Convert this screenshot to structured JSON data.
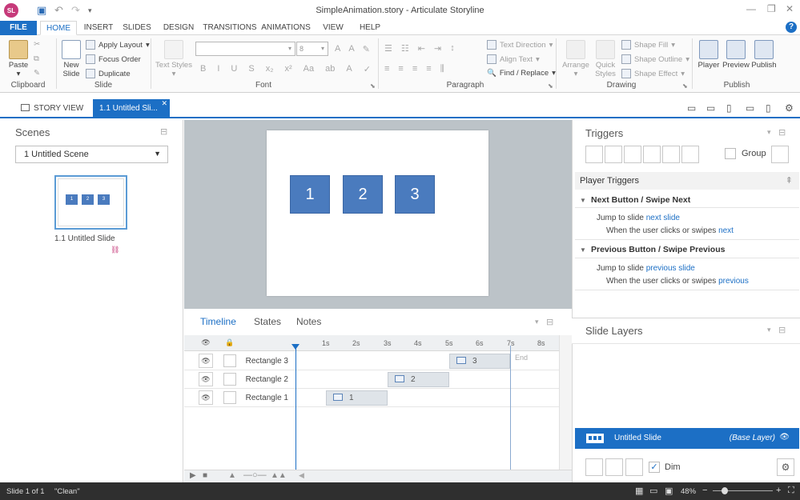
{
  "window": {
    "title": "SimpleAnimation.story - Articulate Storyline",
    "app_badge": "SL"
  },
  "ribbon_tabs": [
    "FILE",
    "HOME",
    "INSERT",
    "SLIDES",
    "DESIGN",
    "TRANSITIONS",
    "ANIMATIONS",
    "VIEW",
    "HELP"
  ],
  "ribbon": {
    "clipboard": {
      "paste": "Paste",
      "label": "Clipboard"
    },
    "slide": {
      "new_slide": "New Slide",
      "apply_layout": "Apply Layout",
      "focus_order": "Focus Order",
      "duplicate": "Duplicate",
      "label": "Slide"
    },
    "font": {
      "text_styles": "Text Styles",
      "size_value": "8",
      "label": "Font"
    },
    "paragraph": {
      "text_direction": "Text Direction",
      "align_text": "Align Text",
      "find_replace": "Find / Replace",
      "label": "Paragraph"
    },
    "drawing": {
      "arrange": "Arrange",
      "quick_styles": "Quick Styles",
      "shape_fill": "Shape Fill",
      "shape_outline": "Shape Outline",
      "shape_effect": "Shape Effect",
      "label": "Drawing"
    },
    "publish": {
      "player": "Player",
      "preview": "Preview",
      "publish": "Publish",
      "label": "Publish"
    }
  },
  "doc_tabs": {
    "story_view": "STORY VIEW",
    "slide": "1.1 Untitled Sli..."
  },
  "scenes": {
    "title": "Scenes",
    "selected_scene": "1 Untitled Scene",
    "thumbnail_label": "1.1 Untitled Slide",
    "thumbnail_boxes": [
      "1",
      "2",
      "3"
    ]
  },
  "stage": {
    "shapes": [
      "1",
      "2",
      "3"
    ]
  },
  "timeline": {
    "tabs": [
      "Timeline",
      "States",
      "Notes"
    ],
    "ticks": [
      "1s",
      "2s",
      "3s",
      "4s",
      "5s",
      "6s",
      "7s",
      "8s"
    ],
    "end_label": "End",
    "rows": [
      {
        "name": "Rectangle 3",
        "bar_label": "3"
      },
      {
        "name": "Rectangle 2",
        "bar_label": "2"
      },
      {
        "name": "Rectangle 1",
        "bar_label": "1"
      }
    ]
  },
  "triggers": {
    "title": "Triggers",
    "group_label": "Group",
    "player_triggers": "Player Triggers",
    "events": [
      {
        "name": "Next Button / Swipe Next",
        "action": "Jump to slide",
        "target": "next slide",
        "condition": "When the user clicks or swipes",
        "condition_target": "next"
      },
      {
        "name": "Previous Button / Swipe Previous",
        "action": "Jump to slide",
        "target": "previous slide",
        "condition": "When the user clicks or swipes",
        "condition_target": "previous"
      }
    ]
  },
  "layers": {
    "title": "Slide Layers",
    "base_name": "Untitled Slide",
    "base_type": "(Base Layer)",
    "dim_label": "Dim"
  },
  "status": {
    "slide_info": "Slide 1 of 1",
    "state": "\"Clean\"",
    "zoom": "48%"
  }
}
